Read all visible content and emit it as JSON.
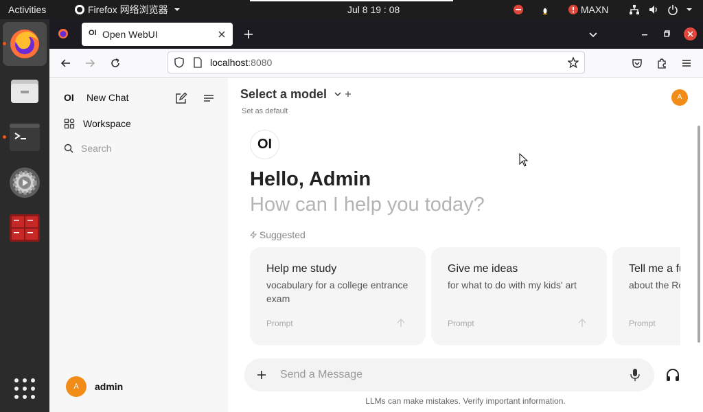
{
  "topbar": {
    "activities": "Activities",
    "app_menu": "Firefox 网络浏览器",
    "clock": "Jul 8  19 : 08",
    "user_label": "MAXN"
  },
  "dock": {
    "apps": [
      {
        "name": "Firefox",
        "icon": "firefox-icon"
      },
      {
        "name": "Files",
        "icon": "files-icon"
      },
      {
        "name": "Terminal",
        "icon": "terminal-icon"
      },
      {
        "name": "Settings",
        "icon": "settings-icon"
      },
      {
        "name": "Workspaces",
        "icon": "workspace-grid-icon"
      }
    ],
    "show_apps_icon": "apps-grid-icon"
  },
  "browser": {
    "tab_title": "Open WebUI",
    "url_host": "localhost",
    "url_port": ":8080"
  },
  "sidebar": {
    "logo": "OI",
    "new_chat": "New Chat",
    "workspace": "Workspace",
    "search_placeholder": "Search",
    "user_initial": "A",
    "user_name": "admin"
  },
  "main": {
    "model_select": "Select a model",
    "set_default": "Set as default",
    "avatar_initial": "A",
    "logo": "OI",
    "greeting": "Hello, Admin",
    "subgreeting": "How can I help you today?",
    "suggested_label": "Suggested",
    "suggestions": [
      {
        "title": "Help me study",
        "subtitle": "vocabulary for a college entrance exam",
        "prompt": "Prompt"
      },
      {
        "title": "Give me ideas",
        "subtitle": "for what to do with my kids' art",
        "prompt": "Prompt"
      },
      {
        "title": "Tell me a fun fact",
        "subtitle": "about the Roman Empire",
        "prompt": "Prompt"
      }
    ],
    "message_placeholder": "Send a Message",
    "disclaimer": "LLMs can make mistakes. Verify important information."
  },
  "colors": {
    "accent_orange": "#f28c18",
    "firefox_close_red": "#e0463a",
    "ubuntu_orange": "#e95420"
  }
}
